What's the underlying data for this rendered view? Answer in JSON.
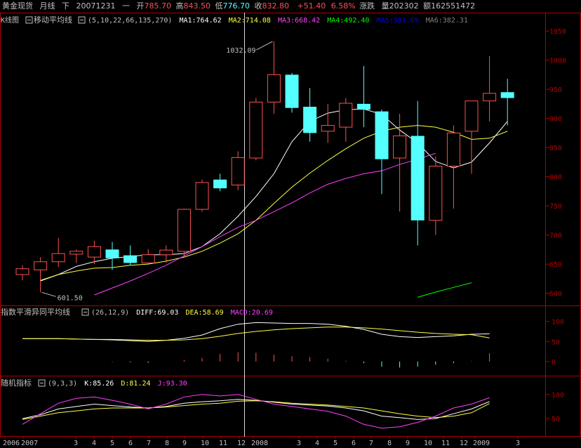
{
  "header": {
    "instrument": "黄金现货",
    "period": "月线",
    "mode": "下",
    "date": "20071231",
    "weekday": "一",
    "open_label": "开",
    "open": "785.70",
    "high_label": "高",
    "high": "843.50",
    "low_label": "低",
    "low": "776.70",
    "close_label": "收",
    "close": "832.80",
    "change_label": "涨跌",
    "change": "+51.40",
    "change_pct": "6.58%",
    "volume_label": "量",
    "volume": "202302",
    "amount_label": "额",
    "amount": "162551472"
  },
  "colors": {
    "up": "#ff5050",
    "down": "#54ffff",
    "ma1": "#ffffff",
    "ma2": "#ffff40",
    "ma3": "#ff40ff",
    "ma4": "#00ff00",
    "ma5": "#0000ff",
    "ma6": "#808080",
    "axis": "#b00000",
    "text": "#c0c0c0"
  },
  "main_panel": {
    "title": "K线图",
    "indicator_name": "移动平均线",
    "params": "(5,10,22,66,135,270)",
    "ma_labels": [
      "MA1:764.62",
      "MA2:714.08",
      "MA3:668.42",
      "MA4:492.40",
      "MA5:391.69",
      "MA6:382.31"
    ],
    "annotation_high": "1032.09",
    "annotation_low": "601.50"
  },
  "macd_panel": {
    "name": "指数平滑异同平均线",
    "params": "(26,12,9)",
    "diff_label": "DIFF:69.03",
    "dea_label": "DEA:58.69",
    "macd_label": "MACD:20.69"
  },
  "kdj_panel": {
    "name": "随机指标",
    "params": "(9,3,3)",
    "k_label": "K:85.26",
    "d_label": "D:81.24",
    "j_label": "J:93.30"
  },
  "chart_data": [
    {
      "type": "candlestick",
      "title": "K线图",
      "y_ticks": [
        600,
        650,
        700,
        750,
        800,
        850,
        900,
        950,
        1000,
        1050
      ],
      "ylim": [
        585,
        1055
      ],
      "x_tick_labels": [
        "2006",
        "2007",
        "3",
        "4",
        "5",
        "6",
        "7",
        "8",
        "9",
        "10",
        "11",
        "12",
        "2008",
        "3",
        "4",
        "5",
        "6",
        "7",
        "8",
        "9",
        "10",
        "11",
        "12",
        "2009",
        "3"
      ],
      "candles": [
        {
          "o": 632,
          "h": 648,
          "l": 622,
          "c": 642
        },
        {
          "o": 640,
          "h": 662,
          "l": 601.5,
          "c": 654
        },
        {
          "o": 654,
          "h": 695,
          "l": 645,
          "c": 668
        },
        {
          "o": 667,
          "h": 675,
          "l": 652,
          "c": 672
        },
        {
          "o": 662,
          "h": 690,
          "l": 650,
          "c": 680
        },
        {
          "o": 675,
          "h": 688,
          "l": 640,
          "c": 660
        },
        {
          "o": 665,
          "h": 682,
          "l": 648,
          "c": 652
        },
        {
          "o": 652,
          "h": 676,
          "l": 650,
          "c": 666
        },
        {
          "o": 666,
          "h": 682,
          "l": 652,
          "c": 674
        },
        {
          "o": 672,
          "h": 745,
          "l": 664,
          "c": 744
        },
        {
          "o": 744,
          "h": 795,
          "l": 740,
          "c": 790
        },
        {
          "o": 795,
          "h": 805,
          "l": 775,
          "c": 780
        },
        {
          "o": 785.7,
          "h": 843.5,
          "l": 776.7,
          "c": 832.8
        },
        {
          "o": 832,
          "h": 935,
          "l": 828,
          "c": 928
        },
        {
          "o": 928,
          "h": 1032.09,
          "l": 908,
          "c": 975
        },
        {
          "o": 975,
          "h": 978,
          "l": 910,
          "c": 918
        },
        {
          "o": 920,
          "h": 952,
          "l": 860,
          "c": 875
        },
        {
          "o": 878,
          "h": 925,
          "l": 858,
          "c": 888
        },
        {
          "o": 885,
          "h": 935,
          "l": 860,
          "c": 926
        },
        {
          "o": 925,
          "h": 990,
          "l": 885,
          "c": 915
        },
        {
          "o": 912,
          "h": 915,
          "l": 770,
          "c": 830
        },
        {
          "o": 832,
          "h": 908,
          "l": 740,
          "c": 870
        },
        {
          "o": 870,
          "h": 930,
          "l": 682,
          "c": 725
        },
        {
          "o": 725,
          "h": 835,
          "l": 700,
          "c": 818
        },
        {
          "o": 818,
          "h": 888,
          "l": 745,
          "c": 875
        },
        {
          "o": 878,
          "h": 930,
          "l": 805,
          "c": 930
        },
        {
          "o": 930,
          "h": 1007,
          "l": 895,
          "c": 943
        },
        {
          "o": 945,
          "h": 968,
          "l": 888,
          "c": 935
        }
      ],
      "ma_series": [
        {
          "name": "MA1",
          "color_key": "ma1",
          "start": 1,
          "values": [
            621,
            632,
            646,
            654,
            660,
            663,
            666,
            666,
            668,
            680,
            702,
            732,
            766,
            805,
            860,
            895,
            909,
            915,
            916,
            907,
            880,
            858,
            826,
            815,
            825,
            858,
            895
          ]
        },
        {
          "name": "MA2",
          "color_key": "ma2",
          "start": 1,
          "values": [
            622,
            632,
            638,
            643,
            644,
            648,
            650,
            655,
            662,
            672,
            686,
            702,
            725,
            754,
            782,
            806,
            828,
            848,
            866,
            878,
            885,
            888,
            885,
            876,
            864,
            866,
            878
          ]
        },
        {
          "name": "MA3",
          "color_key": "ma3",
          "start": 4,
          "values": [
            597,
            609,
            621,
            634,
            648,
            664,
            680,
            697,
            713,
            725,
            740,
            755,
            772,
            787,
            797,
            805,
            810,
            821,
            830,
            840
          ]
        },
        {
          "name": "MA4",
          "color_key": "ma4",
          "start": 22,
          "values": [
            593,
            602,
            610,
            618
          ]
        }
      ]
    },
    {
      "type": "line",
      "title": "MACD",
      "y_ticks": [
        0,
        50,
        100
      ],
      "ylim": [
        -30,
        110
      ],
      "series": [
        {
          "name": "DIFF",
          "values": [
            57,
            57,
            57,
            56,
            55,
            54,
            52,
            50,
            53,
            58,
            66,
            82,
            93,
            97,
            96,
            95,
            95,
            93,
            88,
            80,
            68,
            62,
            60,
            62,
            64,
            68,
            69
          ]
        },
        {
          "name": "DEA",
          "values": [
            57,
            57,
            57,
            56,
            55,
            55,
            54,
            53,
            53,
            54,
            57,
            63,
            70,
            75,
            79,
            82,
            84,
            86,
            86,
            84,
            81,
            77,
            73,
            70,
            68,
            67,
            58.69
          ]
        },
        {
          "name": "MACD",
          "values": [
            0,
            0,
            0,
            0,
            0,
            -1,
            -2,
            -3,
            0,
            4,
            9,
            19,
            23,
            22,
            17,
            13,
            11,
            7,
            2,
            -4,
            -13,
            -15,
            -13,
            -8,
            -4,
            1,
            20.69
          ]
        }
      ]
    },
    {
      "type": "line",
      "title": "KDJ",
      "y_ticks": [
        50,
        100
      ],
      "ylim": [
        15,
        110
      ],
      "series": [
        {
          "name": "K",
          "values": [
            50,
            58,
            70,
            75,
            80,
            77,
            74,
            72,
            75,
            82,
            85,
            87,
            90,
            88,
            84,
            80,
            78,
            76,
            72,
            66,
            55,
            52,
            48,
            50,
            60,
            70,
            85.26
          ]
        },
        {
          "name": "D",
          "values": [
            48,
            55,
            62,
            66,
            70,
            72,
            72,
            72,
            74,
            77,
            80,
            82,
            86,
            87,
            85,
            82,
            80,
            78,
            75,
            72,
            66,
            60,
            55,
            52,
            55,
            62,
            81.24
          ]
        },
        {
          "name": "J",
          "values": [
            38,
            60,
            82,
            92,
            95,
            88,
            80,
            70,
            80,
            95,
            100,
            97,
            100,
            90,
            80,
            75,
            70,
            65,
            55,
            38,
            30,
            33,
            42,
            55,
            72,
            80,
            93.3
          ]
        }
      ]
    }
  ]
}
